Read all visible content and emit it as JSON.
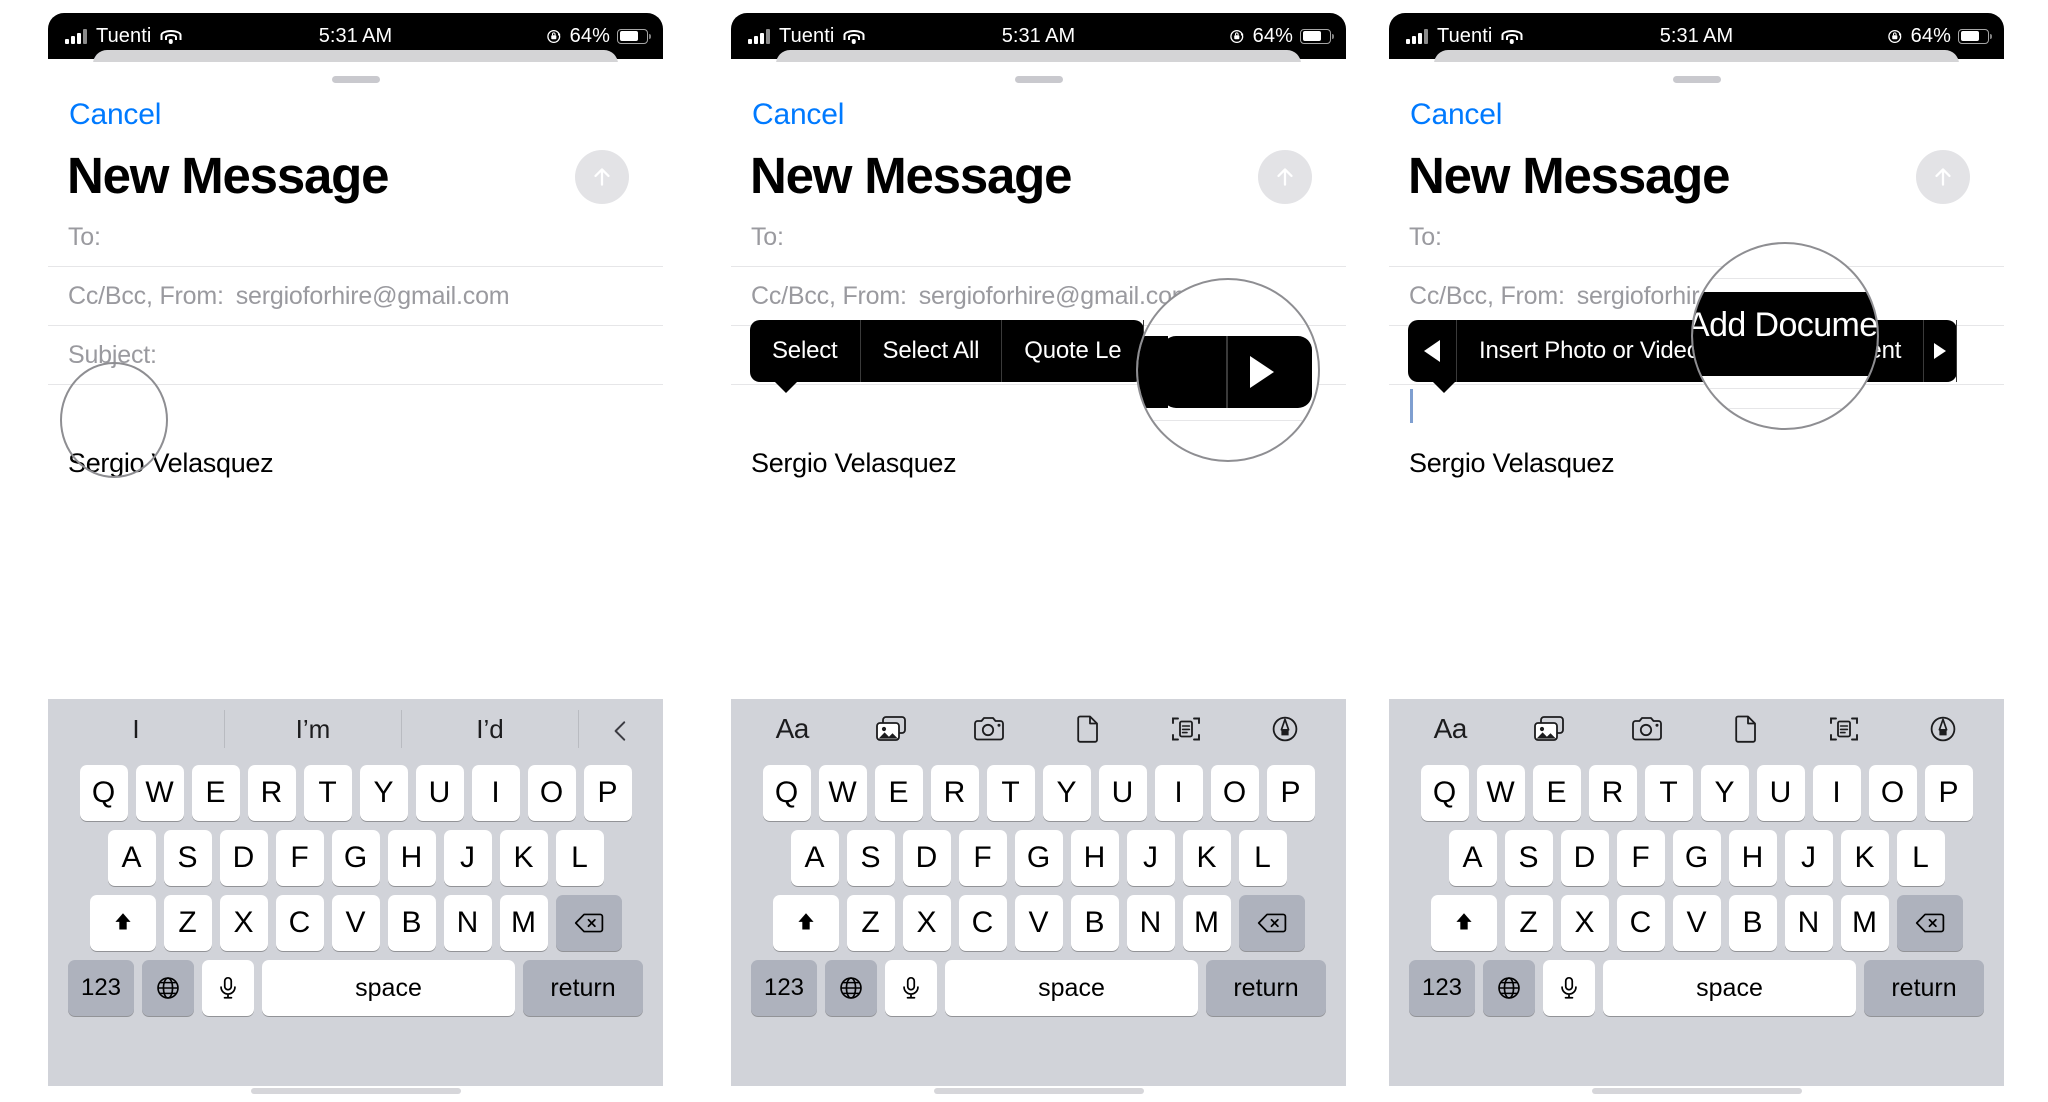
{
  "status_bar": {
    "carrier": "Tuenti",
    "time": "5:31 AM",
    "battery_percent": "64%",
    "signal_icon": "cellular-bars-icon",
    "wifi_icon": "wifi-icon",
    "orientation_lock_icon": "rotation-lock-icon",
    "battery_icon": "battery-icon"
  },
  "sheet": {
    "cancel_label": "Cancel",
    "title": "New Message",
    "send_icon": "send-arrow-up-icon",
    "fields": {
      "to_label": "To:",
      "to_value": "",
      "cc_label": "Cc/Bcc, From:",
      "cc_value": "sergioforhire@gmail.com",
      "subject_label": "Subject:",
      "subject_value": ""
    },
    "signature": "Sergio Velasquez"
  },
  "panels": [
    {
      "id": "panel-1",
      "annotation": "circle-highlight-body-field",
      "context_menu": null
    },
    {
      "id": "panel-2",
      "annotation": "magnifier-next-arrow",
      "context_menu": {
        "items": [
          "Select",
          "Select All",
          "Quote Le"
        ],
        "next_arrow_icon": "triangle-right-icon",
        "prev_arrow_icon": null
      }
    },
    {
      "id": "panel-3",
      "annotation": "magnifier-add-document",
      "context_menu": {
        "items": [
          "Insert Photo or Video",
          "Add Document"
        ],
        "magnified_item": "Add Document",
        "next_arrow_icon": "triangle-right-icon",
        "prev_arrow_icon": "triangle-left-icon"
      }
    }
  ],
  "keyboard": {
    "predictive": [
      "I",
      "I’m",
      "I’d"
    ],
    "predictive_collapse_icon": "chevron-left-icon",
    "toolbar_icons": [
      {
        "name": "format-text-icon",
        "label": "Aa"
      },
      {
        "name": "photo-library-icon",
        "label": ""
      },
      {
        "name": "camera-icon",
        "label": ""
      },
      {
        "name": "document-icon",
        "label": ""
      },
      {
        "name": "scan-document-icon",
        "label": ""
      },
      {
        "name": "markup-pen-icon",
        "label": ""
      }
    ],
    "row1": [
      "Q",
      "W",
      "E",
      "R",
      "T",
      "Y",
      "U",
      "I",
      "O",
      "P"
    ],
    "row2": [
      "A",
      "S",
      "D",
      "F",
      "G",
      "H",
      "J",
      "K",
      "L"
    ],
    "row3": [
      "Z",
      "X",
      "C",
      "V",
      "B",
      "N",
      "M"
    ],
    "shift_icon": "shift-up-arrow-icon",
    "backspace_icon": "backspace-delete-icon",
    "numbers_label": "123",
    "globe_icon": "globe-language-icon",
    "mic_icon": "microphone-icon",
    "space_label": "space",
    "return_label": "return"
  },
  "colors": {
    "accent_blue": "#007aff",
    "status_bar_bg": "#000000",
    "keyboard_bg": "#d1d3d9",
    "key_bg": "#ffffff",
    "key_dark_bg": "#aeb2bd",
    "menu_bg": "#000000",
    "placeholder_gray": "#9a9a9f"
  }
}
